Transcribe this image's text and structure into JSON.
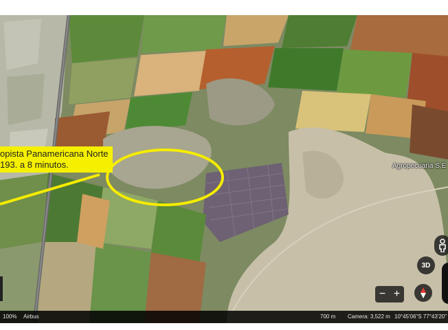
{
  "callout": {
    "line1": "opista Panamericana Norte",
    "line2": "193. a 8 minutos."
  },
  "map_label": "Agropecuaria S.E",
  "controls": {
    "view_3d": "3D",
    "zoom_out": "−",
    "zoom_in": "+"
  },
  "status": {
    "zoom": "100%",
    "imagery": "Airbus",
    "scale": "700 m",
    "camera": "Camera: 3,522 m",
    "coords": "10°45'06\"S 77°43'20\""
  },
  "colors": {
    "highlight": "#f5ec00",
    "callout_bg": "#f5f000"
  }
}
